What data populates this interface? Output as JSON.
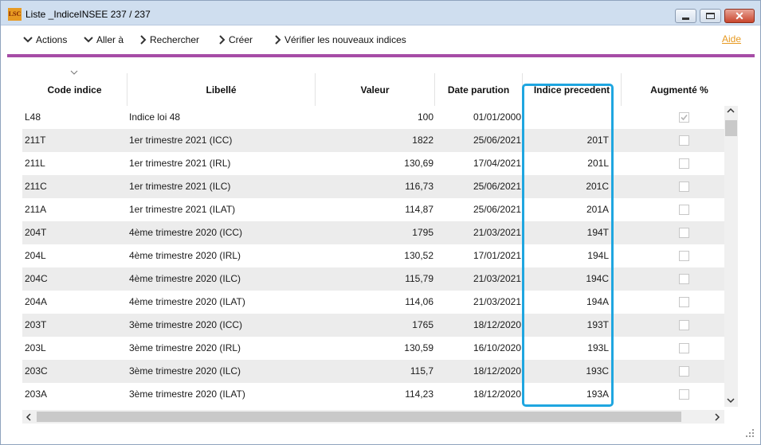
{
  "window": {
    "logo": "LSC",
    "title": "Liste  _IndiceINSEE 237 / 237"
  },
  "toolbar": {
    "items": [
      {
        "label": "Actions"
      },
      {
        "label": "Aller à"
      },
      {
        "label": "Rechercher"
      },
      {
        "label": "Créer"
      },
      {
        "label": "Vérifier les nouveaux indices"
      }
    ],
    "help": "Aide"
  },
  "colors": {
    "accent_bar": "#a64ca6",
    "help_link": "#e79a22",
    "highlight": "#1fa6e0",
    "alt_row": "#ececec"
  },
  "table": {
    "columns": [
      "Code indice",
      "Libellé",
      "Valeur",
      "Date parution",
      "Indice precedent",
      "Augmenté %"
    ],
    "rows": [
      {
        "code": "L48",
        "libelle": "Indice loi 48",
        "valeur": "100",
        "date": "01/01/2000",
        "prev": "",
        "aug": true
      },
      {
        "code": "211T",
        "libelle": "1er trimestre 2021 (ICC)",
        "valeur": "1822",
        "date": "25/06/2021",
        "prev": "201T",
        "aug": false
      },
      {
        "code": "211L",
        "libelle": "1er trimestre 2021 (IRL)",
        "valeur": "130,69",
        "date": "17/04/2021",
        "prev": "201L",
        "aug": false
      },
      {
        "code": "211C",
        "libelle": "1er trimestre 2021 (ILC)",
        "valeur": "116,73",
        "date": "25/06/2021",
        "prev": "201C",
        "aug": false
      },
      {
        "code": "211A",
        "libelle": "1er trimestre 2021 (ILAT)",
        "valeur": "114,87",
        "date": "25/06/2021",
        "prev": "201A",
        "aug": false
      },
      {
        "code": "204T",
        "libelle": "4ème trimestre 2020 (ICC)",
        "valeur": "1795",
        "date": "21/03/2021",
        "prev": "194T",
        "aug": false
      },
      {
        "code": "204L",
        "libelle": "4ème trimestre 2020 (IRL)",
        "valeur": "130,52",
        "date": "17/01/2021",
        "prev": "194L",
        "aug": false
      },
      {
        "code": "204C",
        "libelle": "4ème trimestre 2020 (ILC)",
        "valeur": "115,79",
        "date": "21/03/2021",
        "prev": "194C",
        "aug": false
      },
      {
        "code": "204A",
        "libelle": "4ème trimestre 2020 (ILAT)",
        "valeur": "114,06",
        "date": "21/03/2021",
        "prev": "194A",
        "aug": false
      },
      {
        "code": "203T",
        "libelle": "3ème trimestre 2020 (ICC)",
        "valeur": "1765",
        "date": "18/12/2020",
        "prev": "193T",
        "aug": false
      },
      {
        "code": "203L",
        "libelle": "3ème trimestre 2020 (IRL)",
        "valeur": "130,59",
        "date": "16/10/2020",
        "prev": "193L",
        "aug": false
      },
      {
        "code": "203C",
        "libelle": "3ème trimestre 2020 (ILC)",
        "valeur": "115,7",
        "date": "18/12/2020",
        "prev": "193C",
        "aug": false
      },
      {
        "code": "203A",
        "libelle": "3ème trimestre 2020 (ILAT)",
        "valeur": "114,23",
        "date": "18/12/2020",
        "prev": "193A",
        "aug": false
      }
    ]
  }
}
